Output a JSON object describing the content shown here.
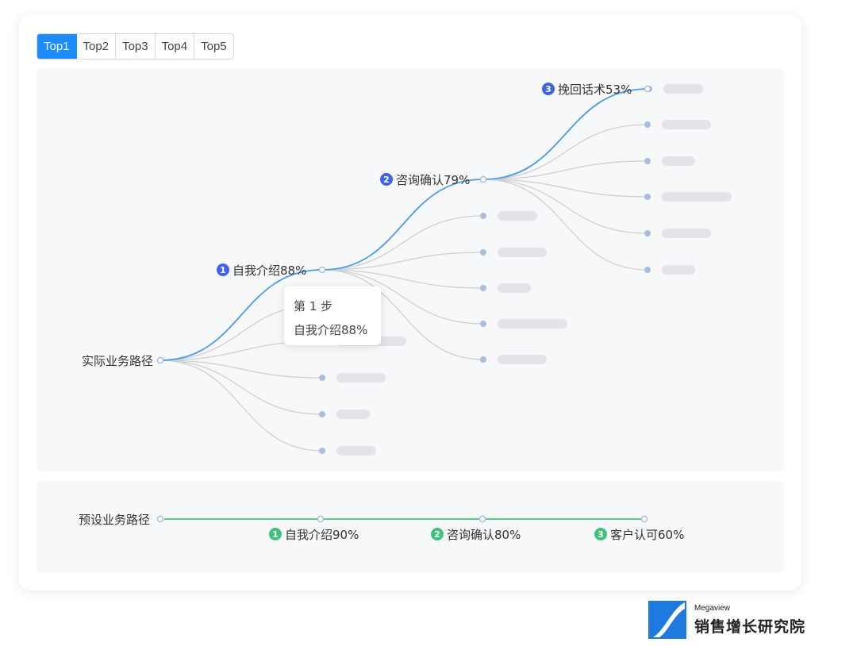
{
  "tabs": [
    {
      "label": "Top1",
      "active": true
    },
    {
      "label": "Top2",
      "active": false
    },
    {
      "label": "Top3",
      "active": false
    },
    {
      "label": "Top4",
      "active": false
    },
    {
      "label": "Top5",
      "active": false
    }
  ],
  "actual_path": {
    "root_label": "实际业务路径",
    "steps": [
      {
        "num": "1",
        "label": "自我介绍88%"
      },
      {
        "num": "2",
        "label": "咨询确认79%"
      },
      {
        "num": "3",
        "label": "挽回话术53%"
      }
    ]
  },
  "tooltip": {
    "title": "第 1 步",
    "value": "自我介绍88%"
  },
  "preset_path": {
    "root_label": "预设业务路径",
    "steps": [
      {
        "num": "1",
        "label": "自我介绍90%"
      },
      {
        "num": "2",
        "label": "咨询确认80%"
      },
      {
        "num": "3",
        "label": "客户认可60%"
      }
    ]
  },
  "colors": {
    "highlight_path": "#4a9cf0",
    "branch": "#cfcfcf",
    "badge_blue": "#3f63e6",
    "badge_green": "#3cc47c",
    "preset_line": "#5cc98f",
    "placeholder": "#e2e4e9",
    "leaf_dot": "#a9bedf"
  },
  "logo": {
    "small": "Megaview",
    "big": "销售增长研究院"
  }
}
